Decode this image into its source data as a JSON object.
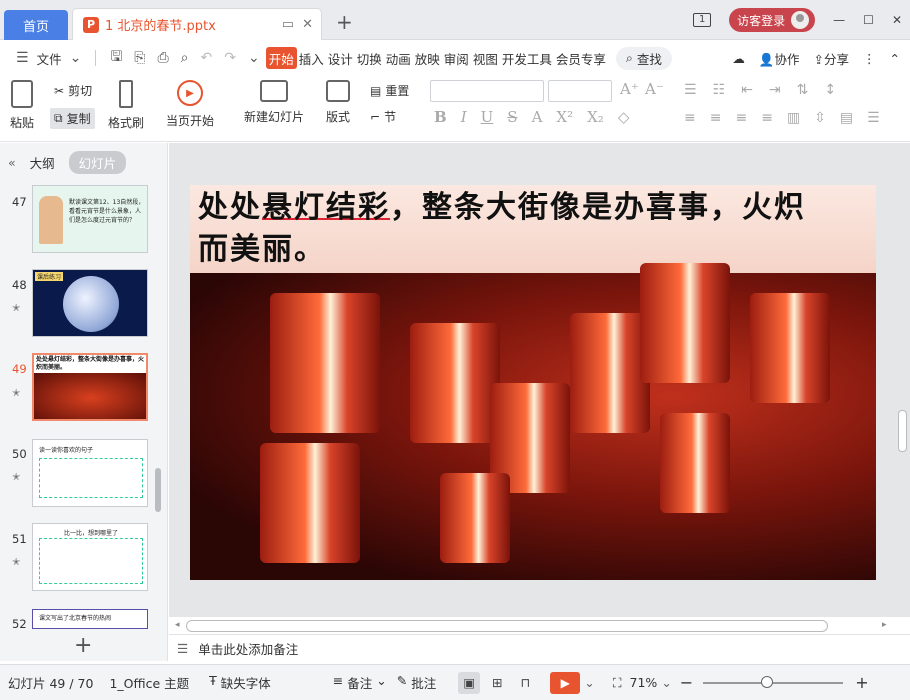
{
  "tabs": {
    "home": "首页",
    "doc_title": "1 北京的春节.pptx"
  },
  "titlebar": {
    "login": "访客登录",
    "badge": "1"
  },
  "menu": {
    "file": "文件",
    "items": [
      "开始",
      "插入",
      "设计",
      "切换",
      "动画",
      "放映",
      "审阅",
      "视图",
      "开发工具",
      "会员专享"
    ],
    "search": "查找",
    "right": [
      "协作",
      "分享"
    ]
  },
  "toolbar": {
    "paste": "粘贴",
    "cut": "剪切",
    "copy": "复制",
    "format_painter": "格式刷",
    "from_current": "当页开始",
    "new_slide": "新建幻灯片",
    "layout": "版式",
    "reset": "重置",
    "section": "节"
  },
  "leftpanel": {
    "outline_tab": "大纲",
    "slides_tab": "幻灯片",
    "slides": [
      {
        "num": "47",
        "text": "默读课文第12、13自然段，看看元宵节是什么景象，人们是怎么度过元宵节的？"
      },
      {
        "num": "48",
        "text": "课后练习"
      },
      {
        "num": "49",
        "text": "处处悬灯结彩，整条大街像是办喜事，火炽而美丽。"
      },
      {
        "num": "50",
        "text": "读一读你喜欢的句子"
      },
      {
        "num": "51",
        "text": "比一比，想到哪里了"
      },
      {
        "num": "52",
        "text": "课文写出了北京春节的热闹"
      }
    ]
  },
  "slide": {
    "line1_a": "处处",
    "line1_b": "悬灯结彩",
    "line1_c": "，整条大街像是办喜事，火炽",
    "line2": "而美丽。"
  },
  "notes": {
    "placeholder": "单击此处添加备注"
  },
  "status": {
    "slide_count": "幻灯片 49 / 70",
    "theme": "1_Office 主题",
    "missing_font": "缺失字体",
    "notes_btn": "备注",
    "comments_btn": "批注",
    "zoom": "71%"
  }
}
